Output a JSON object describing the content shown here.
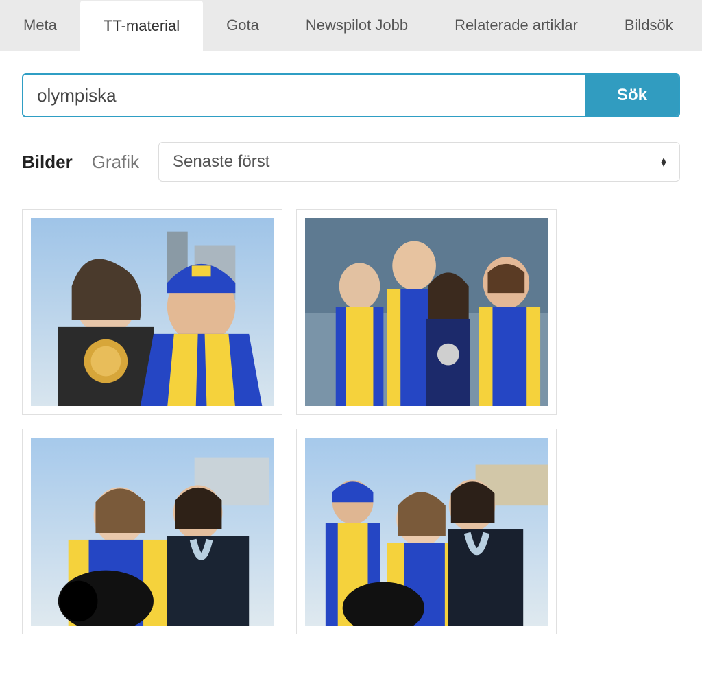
{
  "tabs": [
    {
      "label": "Meta",
      "active": false
    },
    {
      "label": "TT-material",
      "active": true
    },
    {
      "label": "Gota",
      "active": false
    },
    {
      "label": "Newspilot Jobb",
      "active": false
    },
    {
      "label": "Relaterade artiklar",
      "active": false
    },
    {
      "label": "Bildsök",
      "active": false
    }
  ],
  "search": {
    "value": "olympiska",
    "button_label": "Sök"
  },
  "filters": {
    "images_label": "Bilder",
    "graphics_label": "Grafik",
    "sort_selected": "Senaste först"
  },
  "results": [
    {
      "alt": "image-result-1"
    },
    {
      "alt": "image-result-2"
    },
    {
      "alt": "image-result-3"
    },
    {
      "alt": "image-result-4"
    }
  ],
  "colors": {
    "accent": "#319cc0",
    "swe_yellow": "#f5d23c",
    "swe_blue": "#2546c4"
  }
}
